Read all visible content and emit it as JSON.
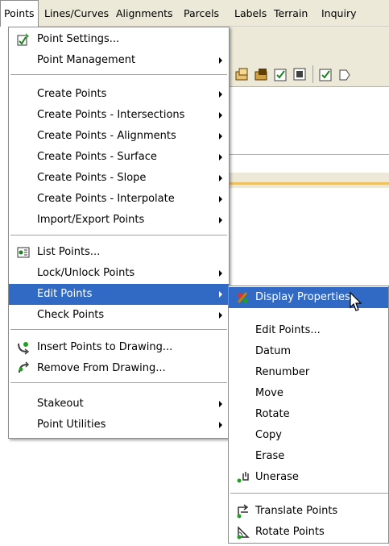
{
  "menubar": [
    {
      "label": "Points",
      "open": true
    },
    {
      "label": "Lines/Curves"
    },
    {
      "label": "Alignments"
    },
    {
      "label": "Parcels"
    },
    {
      "label": "Labels"
    },
    {
      "label": "Terrain"
    },
    {
      "label": "Inquiry"
    }
  ],
  "points_menu": [
    {
      "label": "Point Settings...",
      "icon": "point-settings-icon"
    },
    {
      "label": "Point Management",
      "submenu": true
    },
    {
      "label": "Create Points",
      "submenu": true
    },
    {
      "label": "Create Points - Intersections",
      "submenu": true
    },
    {
      "label": "Create Points - Alignments",
      "submenu": true
    },
    {
      "label": "Create Points - Surface",
      "submenu": true
    },
    {
      "label": "Create Points - Slope",
      "submenu": true
    },
    {
      "label": "Create Points - Interpolate",
      "submenu": true
    },
    {
      "label": "Import/Export Points",
      "submenu": true
    },
    {
      "label": "List Points...",
      "icon": "list-points-icon"
    },
    {
      "label": "Lock/Unlock Points",
      "submenu": true
    },
    {
      "label": "Edit Points",
      "submenu": true,
      "highlighted": true
    },
    {
      "label": "Check Points",
      "submenu": true
    },
    {
      "label": "Insert Points to Drawing...",
      "icon": "insert-points-icon"
    },
    {
      "label": "Remove From Drawing...",
      "icon": "remove-from-drawing-icon"
    },
    {
      "label": "Stakeout",
      "submenu": true
    },
    {
      "label": "Point Utilities",
      "submenu": true
    }
  ],
  "edit_points_submenu": [
    {
      "label": "Display Properties",
      "icon": "display-properties-icon",
      "highlighted": true
    },
    {
      "label": "Edit Points..."
    },
    {
      "label": "Datum"
    },
    {
      "label": "Renumber"
    },
    {
      "label": "Move"
    },
    {
      "label": "Rotate"
    },
    {
      "label": "Copy"
    },
    {
      "label": "Erase"
    },
    {
      "label": "Unerase",
      "icon": "unerase-icon"
    },
    {
      "label": "Translate Points",
      "icon": "translate-points-icon"
    },
    {
      "label": "Rotate Points",
      "icon": "rotate-points-icon"
    }
  ],
  "colors": {
    "highlight": "#316ac5",
    "menubar": "#ece9d8"
  }
}
